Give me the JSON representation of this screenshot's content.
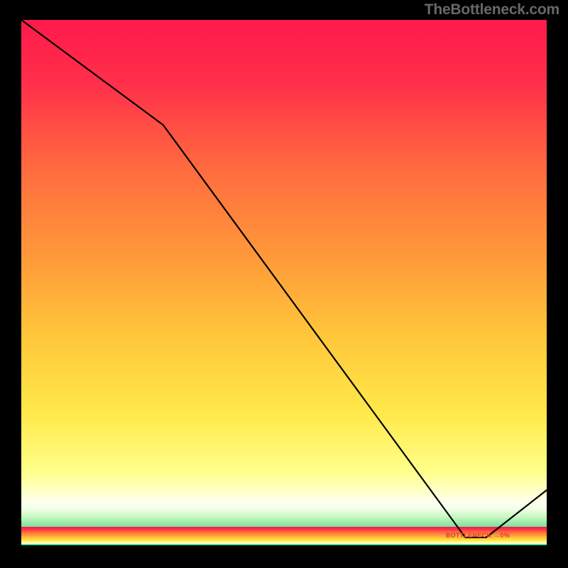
{
  "watermark": "TheBottleneck.com",
  "bottleneck_label": "BOTTLENECK →0%",
  "chart_data": {
    "type": "line",
    "title": "",
    "xlabel": "",
    "ylabel": "",
    "xlim": [
      0,
      1
    ],
    "ylim": [
      0,
      1
    ],
    "x": [
      0.0,
      0.27,
      0.845,
      0.885,
      1.0
    ],
    "values": [
      1.0,
      0.8,
      0.015,
      0.015,
      0.105
    ],
    "bottleneck_x_range": [
      0.84,
      0.9
    ],
    "gradient_stops": [
      {
        "t": 0.0,
        "color": "#ff1a4b"
      },
      {
        "t": 0.12,
        "color": "#ff2f4a"
      },
      {
        "t": 0.28,
        "color": "#ff6a3f"
      },
      {
        "t": 0.45,
        "color": "#ff993a"
      },
      {
        "t": 0.6,
        "color": "#ffc63a"
      },
      {
        "t": 0.75,
        "color": "#ffe94a"
      },
      {
        "t": 0.86,
        "color": "#ffff8a"
      },
      {
        "t": 0.905,
        "color": "#ffffd5"
      },
      {
        "t": 0.918,
        "color": "#fdfff0"
      },
      {
        "t": 0.93,
        "color": "#f2ffe8"
      },
      {
        "t": 0.945,
        "color": "#caf8c2"
      },
      {
        "t": 0.962,
        "color": "#86e6a2"
      },
      {
        "t": 0.978,
        "color": "#2edb91"
      },
      {
        "t": 0.992,
        "color": "#0ed08a"
      },
      {
        "t": 1.0,
        "color": "#0bce88"
      }
    ]
  }
}
